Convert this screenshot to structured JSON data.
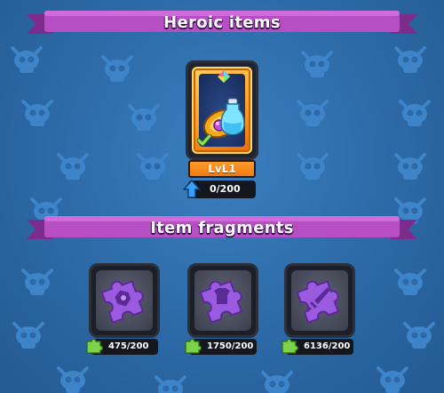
{
  "sections": {
    "heroic_title": "Heroic items",
    "fragments_title": "Item fragments"
  },
  "heroic_item": {
    "level": "LvL1",
    "progress": "0/200",
    "equipped": true
  },
  "fragments": [
    {
      "progress": "475/200",
      "icon": "shield-emblem-puzzle-icon"
    },
    {
      "progress": "1750/200",
      "icon": "armor-puzzle-icon"
    },
    {
      "progress": "6136/200",
      "icon": "sword-puzzle-icon"
    }
  ],
  "colors": {
    "background": "#2c69a6",
    "ribbon": "#b84ec4",
    "hero_frame": "#ff9a1e",
    "puzzle": "#9b5be0",
    "fragment_icon": "#7cd34a"
  }
}
